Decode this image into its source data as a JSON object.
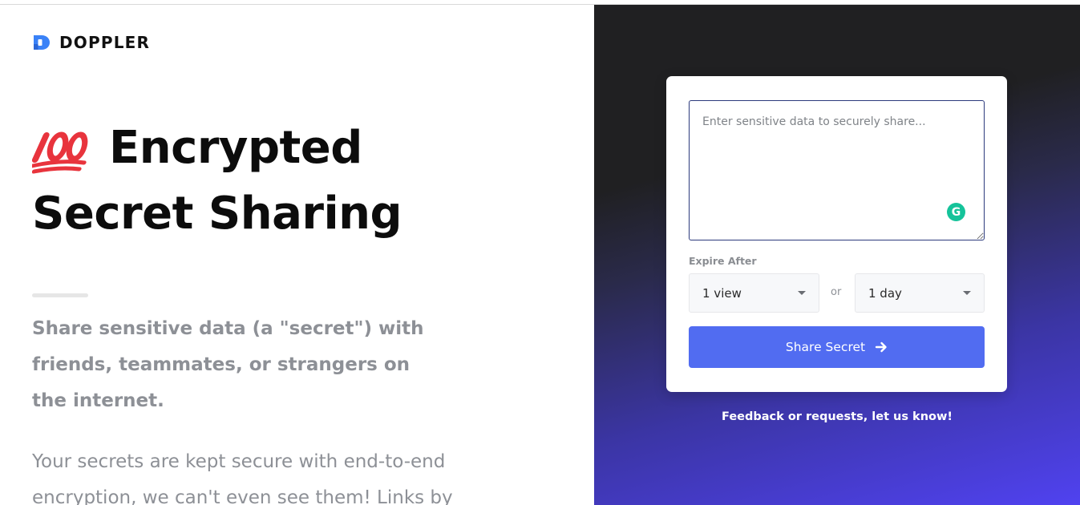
{
  "brand": {
    "name": "DOPPLER",
    "logo_icon": "doppler-logo-icon"
  },
  "hero": {
    "emoji_icon": "hundred-points-emoji",
    "line1": "Encrypted",
    "line2": "Secret Sharing"
  },
  "lead": "Share sensitive data (a \"secret\") with friends, teammates, or strangers on the internet.",
  "body_text": "Your secrets are kept secure with end-to-end encryption, we can't even see them! Links by",
  "form": {
    "secret_placeholder": "Enter sensitive data to securely share...",
    "expire_label": "Expire After",
    "views_value": "1 view",
    "or_label": "or",
    "days_value": "1 day",
    "share_button": "Share Secret"
  },
  "feedback_link": "Feedback or requests, let us know!",
  "colors": {
    "accent_button": "#516cf1",
    "right_panel_dark": "#202022",
    "right_panel_purple": "#5042f0",
    "grammarly_green": "#15c39a",
    "brand_blue": "#3a82f7",
    "emoji_red": "#e8343d"
  }
}
